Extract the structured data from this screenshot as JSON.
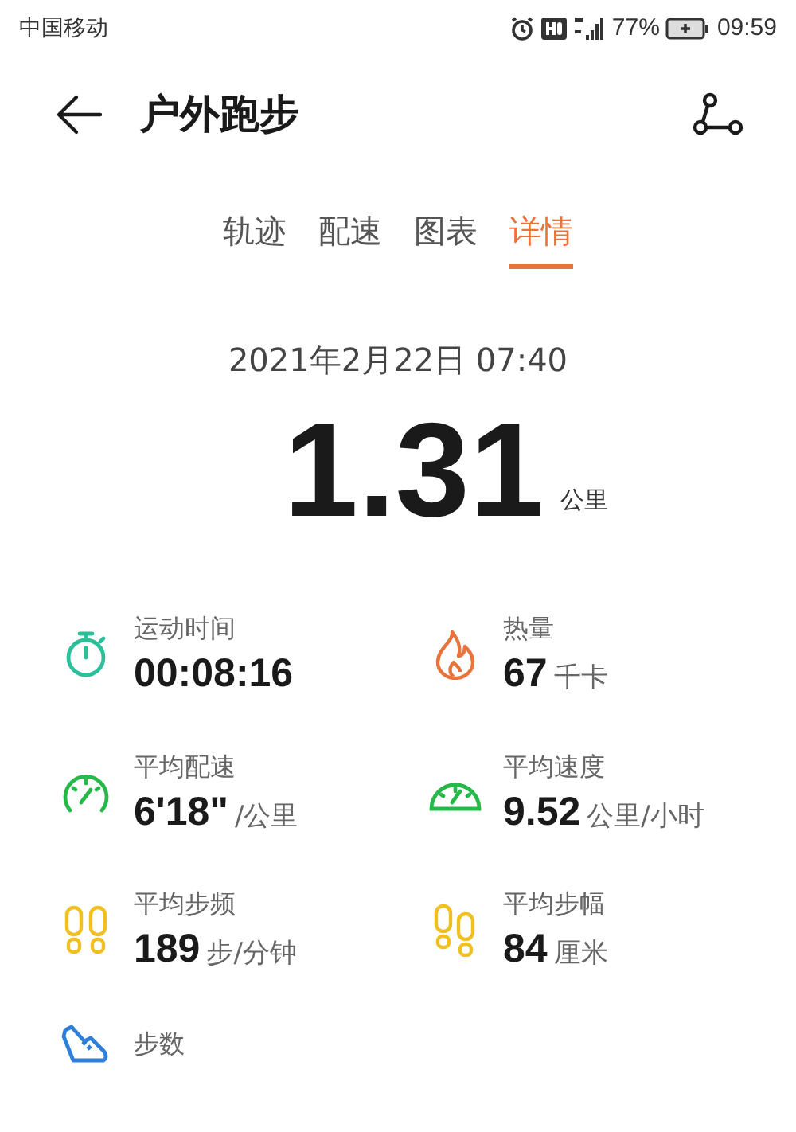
{
  "status_bar": {
    "carrier": "中国移动",
    "battery": "77%",
    "time": "09:59"
  },
  "header": {
    "title": "户外跑步"
  },
  "tabs": [
    {
      "label": "轨迹",
      "selected": false
    },
    {
      "label": "配速",
      "selected": false
    },
    {
      "label": "图表",
      "selected": false
    },
    {
      "label": "详情",
      "selected": true
    }
  ],
  "summary": {
    "date": "2021年2月22日 07:40",
    "distance": "1.31",
    "unit": "公里"
  },
  "metrics": [
    {
      "kind": "duration",
      "label": "运动时间",
      "value": "00:08:16"
    },
    {
      "kind": "calories",
      "label": "热量",
      "value": "67",
      "unit": "千卡"
    },
    {
      "kind": "pace",
      "label": "平均配速",
      "value": "6'18\"",
      "unit": "/公里"
    },
    {
      "kind": "speed",
      "label": "平均速度",
      "value": "9.52",
      "unit": "公里/小时"
    },
    {
      "kind": "cadence",
      "label": "平均步频",
      "value": "189",
      "unit": "步/分钟"
    },
    {
      "kind": "stride",
      "label": "平均步幅",
      "value": "84",
      "unit": "厘米"
    },
    {
      "kind": "steps",
      "label": "步数"
    }
  ]
}
